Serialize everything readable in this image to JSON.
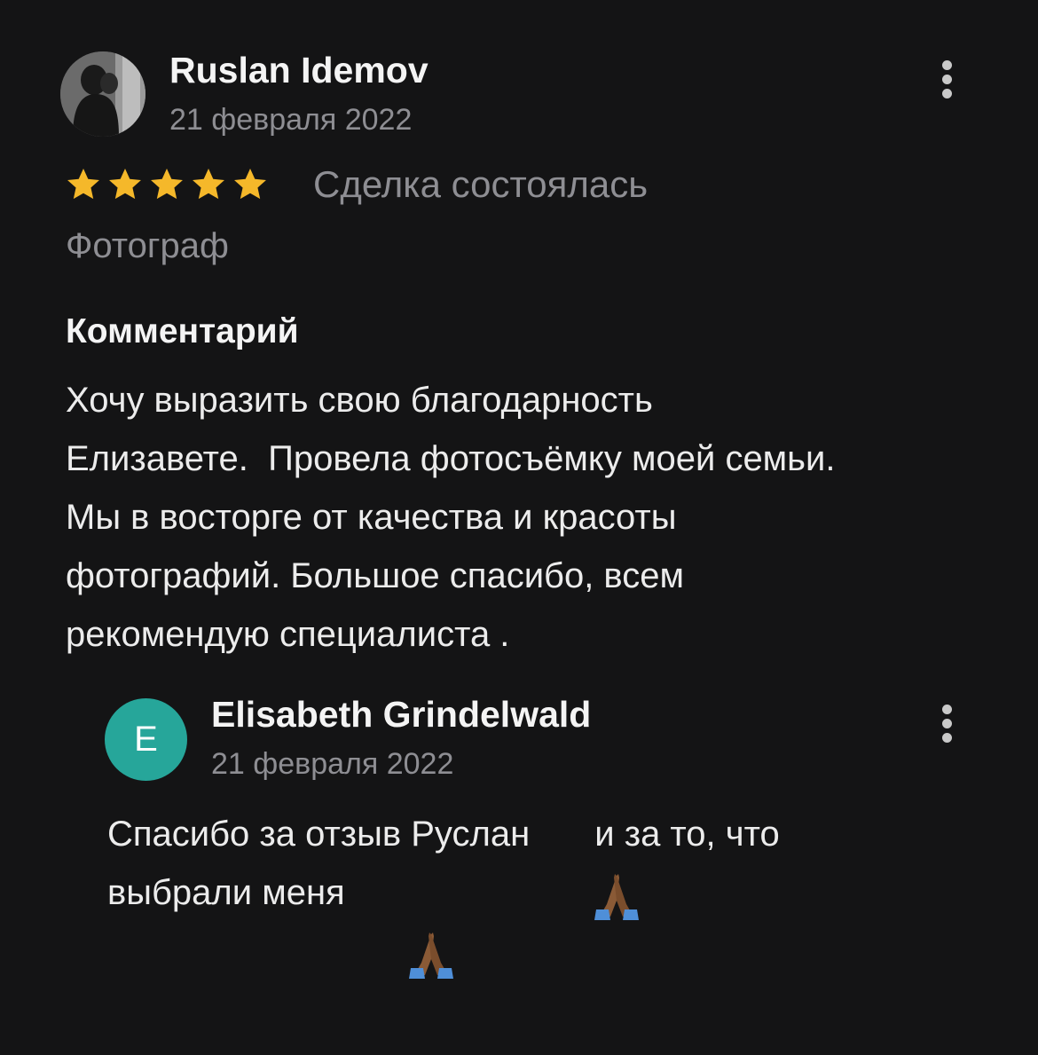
{
  "review": {
    "author_name": "Ruslan Idemov",
    "date": "21 февраля 2022",
    "rating": 5,
    "rating_max": 5,
    "deal_status": "Сделка состоялась",
    "category": "Фотограф",
    "comment_heading": "Комментарий",
    "comment_lines": [
      "Хочу выразить свою благодарность",
      "Елизавете.  Провела фотосъёмку моей семьи.",
      "Мы в восторге от качества и красоты",
      "фотографий. Большое спасибо, всем",
      "рекомендую специалиста ."
    ]
  },
  "reply": {
    "avatar_letter": "E",
    "author_name": "Elisabeth Grindelwald",
    "date": "21 февраля 2022",
    "line1_text": "Спасибо за отзыв Руслан",
    "line1_after": " и за то, что",
    "line2_text": "выбрали меня"
  },
  "colors": {
    "background": "#141415",
    "star": "#f5b82a",
    "reply_avatar": "#26a69a",
    "secondary_text": "#8e8e93"
  },
  "icons": {
    "more": "more-vertical-icon",
    "star": "star-icon",
    "emoji": "folded-hands-emoji"
  }
}
